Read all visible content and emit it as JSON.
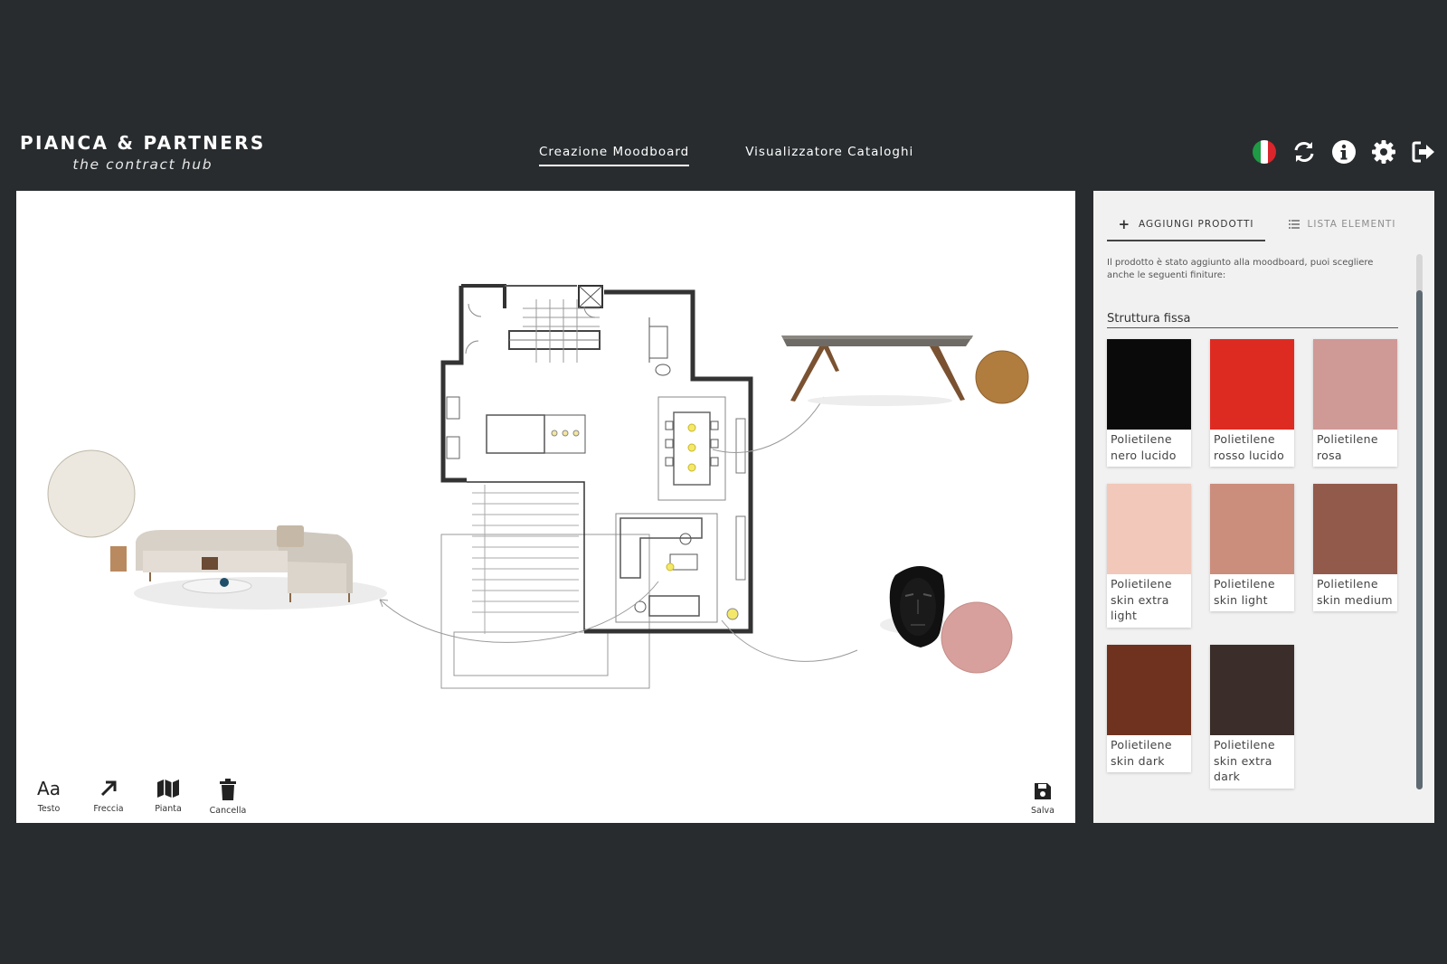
{
  "brand": {
    "name": "PIANCA & PARTNERS",
    "tagline": "the contract hub"
  },
  "nav": {
    "items": [
      {
        "label": "Creazione Moodboard",
        "active": true
      },
      {
        "label": "Visualizzatore Cataloghi",
        "active": false
      }
    ]
  },
  "header_icons": [
    "italy-flag-icon",
    "refresh-icon",
    "info-icon",
    "settings-icon",
    "logout-icon"
  ],
  "toolbar": {
    "tools": [
      {
        "label": "Testo",
        "icon": "text-icon",
        "glyph": "Aa"
      },
      {
        "label": "Freccia",
        "icon": "arrow-icon"
      },
      {
        "label": "Pianta",
        "icon": "map-icon"
      },
      {
        "label": "Cancella",
        "icon": "trash-icon"
      }
    ],
    "save_label": "Salva"
  },
  "panel": {
    "tabs": [
      {
        "label": "AGGIUNGI PRODOTTI",
        "icon": "plus-icon",
        "active": true
      },
      {
        "label": "LISTA ELEMENTI",
        "icon": "list-icon",
        "active": false
      }
    ],
    "info_text": "Il prodotto è stato aggiunto alla moodboard, puoi scegliere anche le seguenti finiture:",
    "section_title": "Struttura fissa",
    "finishes": [
      {
        "label": "Polietilene nero lucido",
        "color": "#0a0a0a"
      },
      {
        "label": "Polietilene rosso lucido",
        "color": "#de2b22"
      },
      {
        "label": "Polietilene rosa",
        "color": "#cf9996"
      },
      {
        "label": "Polietilene skin extra light",
        "color": "#f1c8b9"
      },
      {
        "label": "Polietilene skin light",
        "color": "#cb8d7c"
      },
      {
        "label": "Polietilene skin medium",
        "color": "#925a4a"
      },
      {
        "label": "Polietilene skin dark",
        "color": "#6e321f"
      },
      {
        "label": "Polietilene skin extra dark",
        "color": "#3a2d2a"
      }
    ]
  },
  "colors": {
    "background": "#282c2f",
    "canvas": "#ffffff",
    "panel": "#f1f1f1",
    "accent": "#ffffff"
  }
}
